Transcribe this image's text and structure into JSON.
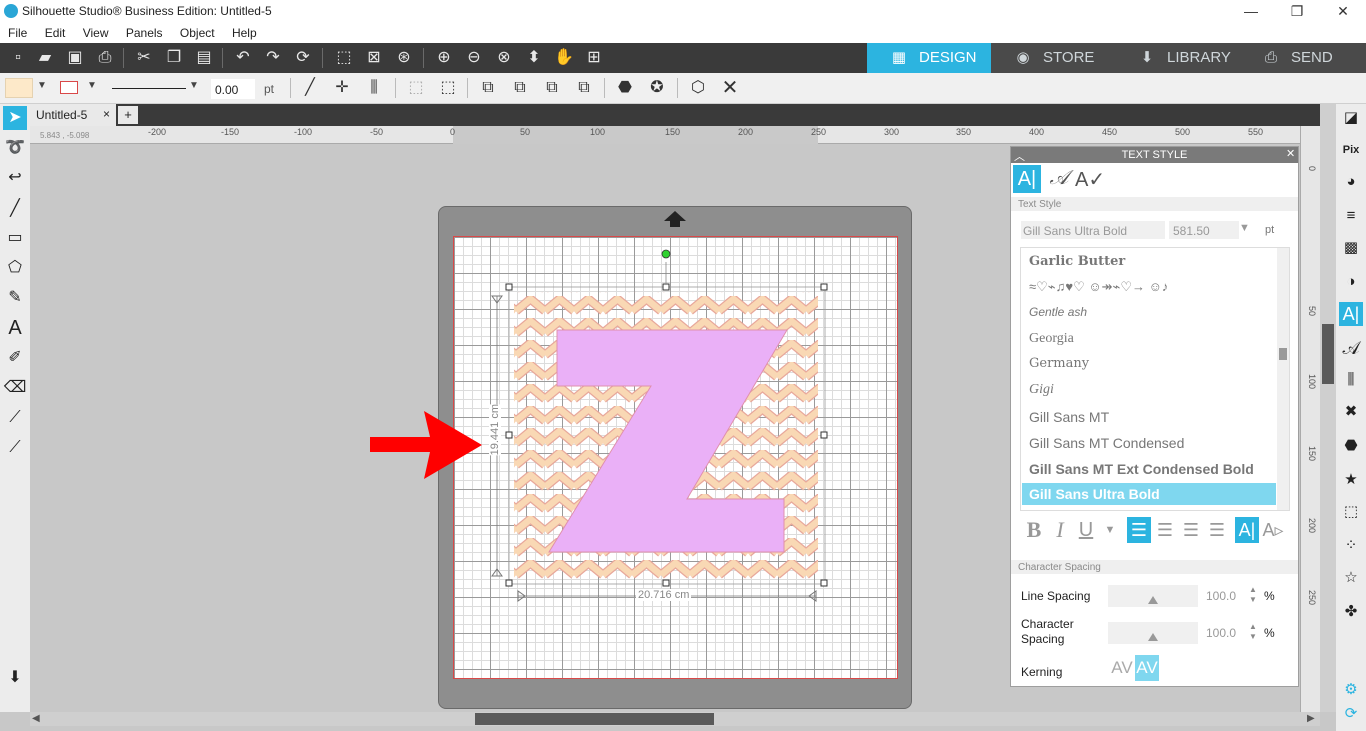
{
  "window": {
    "title": "Silhouette Studio® Business Edition: Untitled-5"
  },
  "menu": [
    "File",
    "Edit",
    "View",
    "Panels",
    "Object",
    "Help"
  ],
  "nav_tabs": [
    {
      "label": "DESIGN",
      "icon": "grid-icon"
    },
    {
      "label": "STORE",
      "icon": "store-icon"
    },
    {
      "label": "LIBRARY",
      "icon": "library-icon"
    },
    {
      "label": "SEND",
      "icon": "send-icon"
    }
  ],
  "line_settings": {
    "width_value": "0.00",
    "unit": "pt"
  },
  "document_tab": {
    "label": "Untitled-5",
    "close": "×",
    "add": "+"
  },
  "ruler": {
    "h_ticks": [
      "-200",
      "-150",
      "-100",
      "-50",
      "0",
      "50",
      "100",
      "150",
      "200",
      "250",
      "300",
      "350",
      "400",
      "450",
      "500",
      "550"
    ],
    "v_ticks": [
      "0",
      "50",
      "100",
      "150",
      "200",
      "250"
    ],
    "cursor_readout": "5.843 , -5.098"
  },
  "selection": {
    "width_label": "20.716 cm",
    "height_label": "19.441 cm"
  },
  "design": {
    "letter": "Z",
    "letter_color": "#e9adf5",
    "pattern_color": "#f5cfa7"
  },
  "text_style": {
    "header": "TEXT STYLE",
    "section_label": "Text Style",
    "font_value": "Gill Sans Ultra Bold",
    "size_value": "581.50",
    "size_unit": "pt",
    "fonts": [
      "Garlic Butter",
      "≈♡⌁♫♥♡ ☺↠⌁♡→ ☺♪",
      "Gentle ash",
      "Georgia",
      "Germany",
      "Gigi",
      "Gill Sans MT",
      "Gill Sans MT Condensed",
      "Gill Sans MT Ext Condensed Bold",
      "Gill Sans Ultra Bold"
    ],
    "selected_font": "Gill Sans Ultra Bold",
    "format_buttons": {
      "bold": "B",
      "italic": "I",
      "underline": "U"
    },
    "char_section_label": "Character Spacing",
    "line_spacing_label": "Line Spacing",
    "line_spacing_value": "100.0",
    "char_spacing_label": "Character Spacing",
    "char_spacing_value": "100.0",
    "percent": "%",
    "kerning_label": "Kerning",
    "kerning_value": "AV"
  },
  "colors": {
    "accent": "#2cb4e0",
    "toolbar_dark": "#3a3a3a",
    "arrow_red": "#ff0000"
  }
}
